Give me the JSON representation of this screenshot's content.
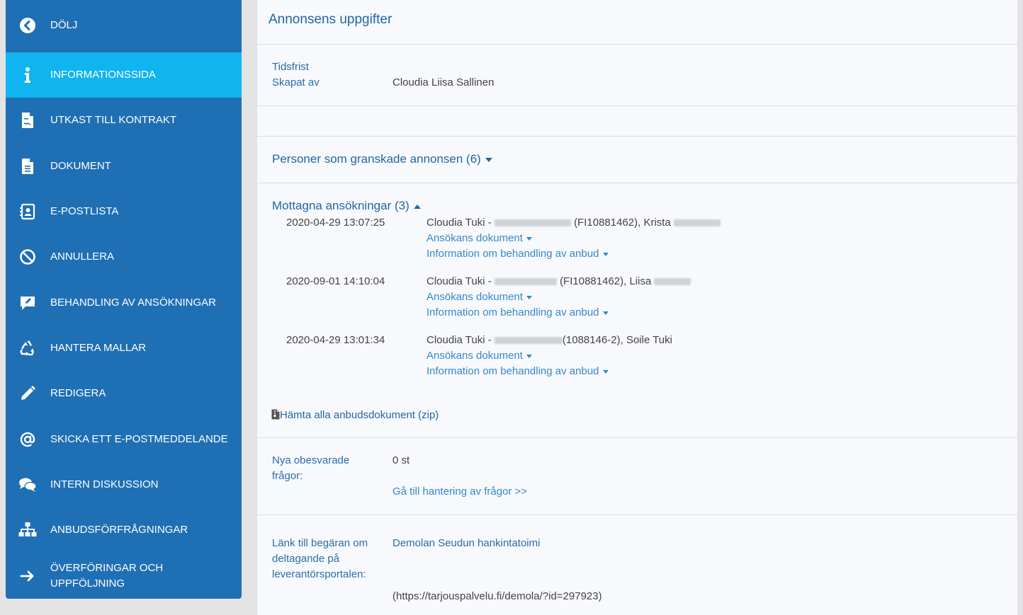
{
  "sidebar": {
    "items": [
      {
        "label": "DÖLJ",
        "icon": "chevron-left-circle-icon"
      },
      {
        "label": "INFORMATIONSSIDA",
        "icon": "info-icon",
        "active": true
      },
      {
        "label": "UTKAST TILL KONTRAKT",
        "icon": "contract-file-icon"
      },
      {
        "label": "DOKUMENT",
        "icon": "document-icon"
      },
      {
        "label": "E-POSTLISTA",
        "icon": "address-book-icon"
      },
      {
        "label": "ANNULLERA",
        "icon": "ban-icon"
      },
      {
        "label": "BEHANDLING AV ANSÖKNINGAR",
        "icon": "edit-comment-icon"
      },
      {
        "label": "HANTERA MALLAR",
        "icon": "recycle-icon"
      },
      {
        "label": "REDIGERA",
        "icon": "pencil-icon"
      },
      {
        "label": "SKICKA ETT E-POSTMEDDELANDE",
        "icon": "at-sign-icon"
      },
      {
        "label": "INTERN DISKUSSION",
        "icon": "comments-icon"
      },
      {
        "label": "ANBUDSFÖRFRÅGNINGAR",
        "icon": "sitemap-icon"
      },
      {
        "label_line1": "ÖVERFÖRINGAR OCH",
        "label_line2": "UPPFÖLJNING",
        "icon": "arrow-right-icon"
      }
    ]
  },
  "main": {
    "title": "Annonsens uppgifter",
    "info": {
      "deadline_label": "Tidsfrist",
      "created_by_label": "Skapat av",
      "created_by_value": "Cloudia Liisa Sallinen"
    },
    "reviewers": {
      "label": "Personer som granskade annonsen (6)"
    },
    "applications": {
      "label": "Mottagna ansökningar (3)",
      "items": [
        {
          "date": "2020-04-29 13:07:25",
          "prefix": "Cloudia Tuki -",
          "mid": "(FI10881462), Krista",
          "docs_link": "Ansökans dokument",
          "info_link": "Information om behandling av anbud"
        },
        {
          "date": "2020-09-01 14:10:04",
          "prefix": "Cloudia Tuki -",
          "mid": "(FI10881462), Liisa",
          "docs_link": "Ansökans dokument",
          "info_link": "Information om behandling av anbud"
        },
        {
          "date": "2020-04-29 13:01:34",
          "prefix": "Cloudia Tuki -",
          "mid": "(1088146-2), Soile Tuki",
          "docs_link": "Ansökans dokument",
          "info_link": "Information om behandling av anbud"
        }
      ],
      "download_link": "Hämta alla anbudsdokument (zip)"
    },
    "questions": {
      "label": "Nya obesvarade frågor:",
      "value": "0 st",
      "link": "Gå till hantering av frågor >>"
    },
    "portal": {
      "label": "Länk till begäran om deltagande på leverantörsportalen:",
      "link": "Demolan Seudun hankintatoimi",
      "url": "(https://tarjouspalvelu.fi/demola/?id=297923)"
    }
  }
}
